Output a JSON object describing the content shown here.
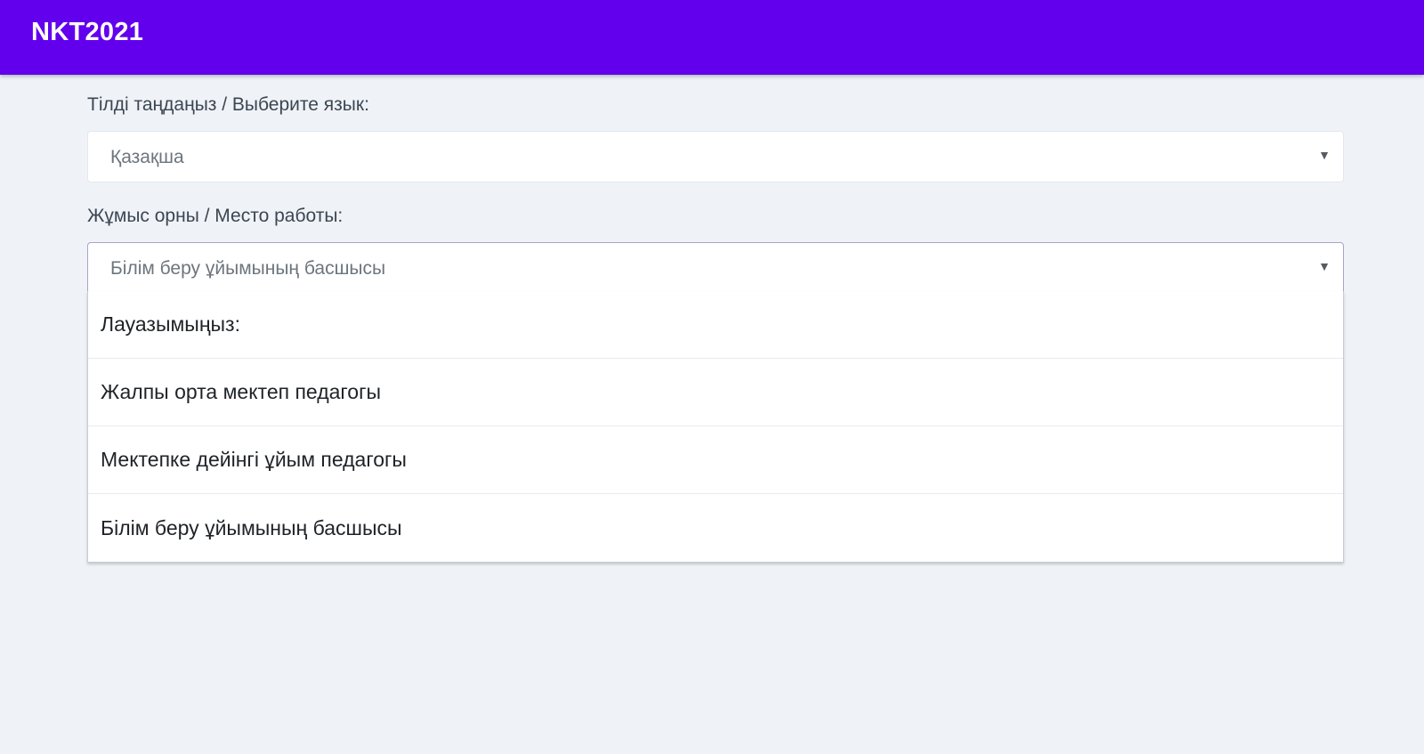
{
  "app": {
    "title": "NKT2021"
  },
  "language": {
    "label": "Тілді таңдаңыз / Выберите язык:",
    "selected": "Қазақша"
  },
  "workplace": {
    "label": "Жұмыс орны / Место работы:",
    "selected": "Білім беру ұйымының басшысы",
    "options": [
      "Лауазымыңыз:",
      "Жалпы орта мектеп педагогы",
      "Мектепке дейінгі ұйым педагогы",
      "Білім беру ұйымының басшысы"
    ]
  },
  "icons": {
    "caret": "caret-down-icon"
  },
  "colors": {
    "topbar": "#6200ee",
    "background": "#eff3f8"
  }
}
